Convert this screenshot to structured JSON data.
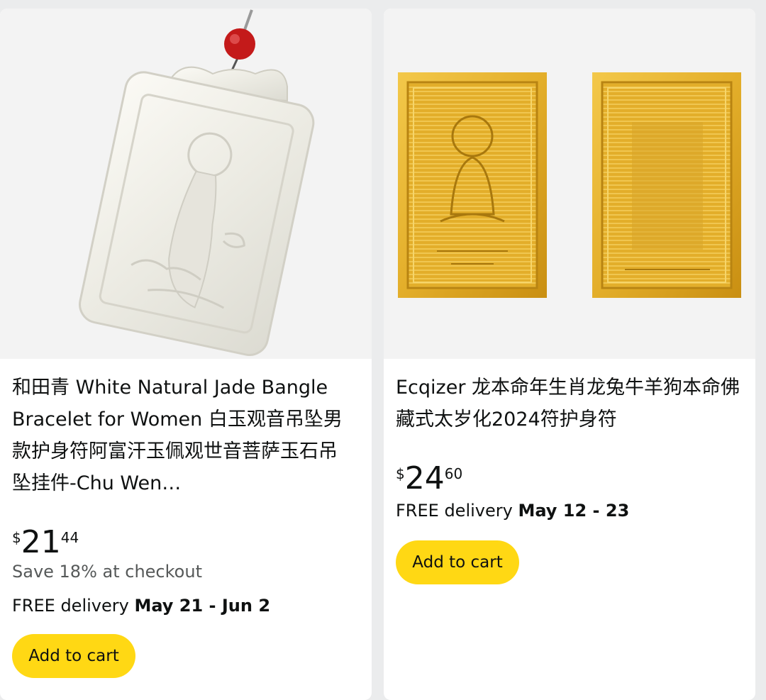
{
  "products": [
    {
      "title": "和田青 White Natural Jade Bangle Bracelet for Women 白玉观音吊坠男款护身符阿富汗玉佩观世音菩萨玉石吊坠挂件-Chu Wen…",
      "price": {
        "symbol": "$",
        "whole": "21",
        "fraction": "44"
      },
      "savings": "Save 18% at checkout",
      "delivery_prefix": "FREE delivery ",
      "delivery_dates": "May 21 - Jun 2",
      "button_label": "Add to cart",
      "image": "white-jade-guanyin-pendant"
    },
    {
      "title": "Ecqizer 龙本命年生肖龙兔牛羊狗本命佛藏式太岁化2024符护身符",
      "price": {
        "symbol": "$",
        "whole": "24",
        "fraction": "60"
      },
      "delivery_prefix": "FREE delivery ",
      "delivery_dates": "May 12 - 23",
      "button_label": "Add to cart",
      "image": "gold-buddha-amulet-cards"
    }
  ],
  "colors": {
    "page_bg": "#ebeced",
    "card_bg": "#ffffff",
    "button_bg": "#ffd814",
    "text": "#0f1111",
    "muted_text": "#565959",
    "gold": "#d9a520",
    "jade": "#eceae2"
  }
}
